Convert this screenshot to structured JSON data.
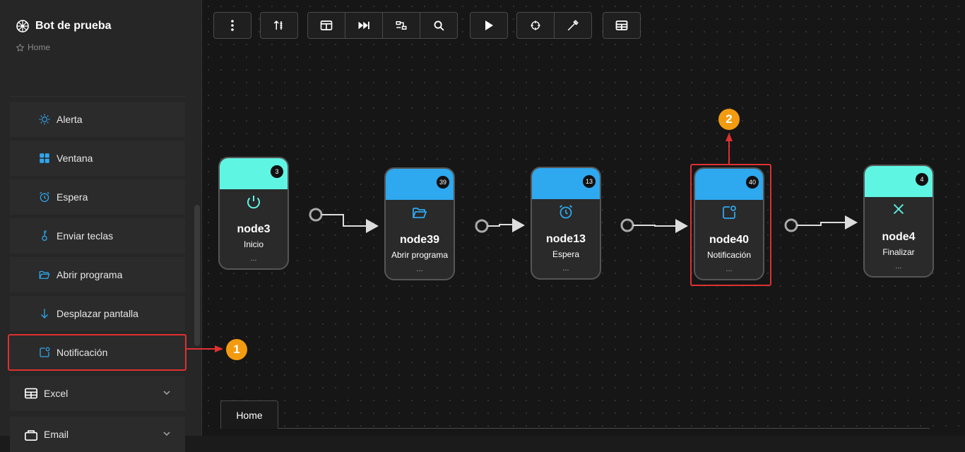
{
  "app": {
    "title": "Bot de prueba",
    "breadcrumb": "Home"
  },
  "sidebar": {
    "items": [
      {
        "label": "Alerta",
        "icon": "sun-icon"
      },
      {
        "label": "Ventana",
        "icon": "window-grid-icon"
      },
      {
        "label": "Espera",
        "icon": "alarm-clock-icon"
      },
      {
        "label": "Enviar teclas",
        "icon": "key-icon"
      },
      {
        "label": "Abrir programa",
        "icon": "folder-open-icon"
      },
      {
        "label": "Desplazar pantalla",
        "icon": "arrow-down-icon"
      },
      {
        "label": "Notificación",
        "icon": "notification-icon"
      }
    ],
    "groups": [
      {
        "label": "Excel",
        "icon": "table-icon"
      },
      {
        "label": "Email",
        "icon": "email-icon"
      }
    ]
  },
  "nodes": [
    {
      "name": "node3",
      "label": "Inicio",
      "badge": "3",
      "dots": "...",
      "color": "#5ff5e3",
      "icon": "power-icon"
    },
    {
      "name": "node39",
      "label": "Abrir programa",
      "badge": "39",
      "dots": "...",
      "color": "#2ea8ef",
      "icon": "folder-open-icon"
    },
    {
      "name": "node13",
      "label": "Espera",
      "badge": "13",
      "dots": "...",
      "color": "#2ea8ef",
      "icon": "alarm-clock-icon"
    },
    {
      "name": "node40",
      "label": "Notificación",
      "badge": "40",
      "dots": "...",
      "color": "#2ea8ef",
      "icon": "notification-icon"
    },
    {
      "name": "node4",
      "label": "Finalizar",
      "badge": "4",
      "dots": "...",
      "color": "#5ff5e3",
      "icon": "close-icon"
    }
  ],
  "markers": {
    "one": "1",
    "two": "2"
  },
  "tabs": [
    {
      "label": "Home"
    }
  ],
  "colors": {
    "accent": "#2ea8ef",
    "highlight": "#e03030",
    "marker": "#f29b11"
  }
}
